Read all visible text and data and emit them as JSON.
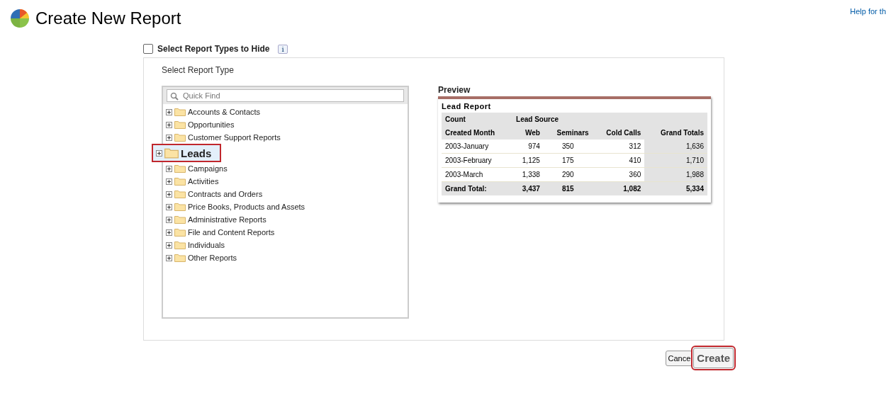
{
  "header": {
    "title": "Create New Report",
    "help_link": "Help for th"
  },
  "hide_option": {
    "label": "Select Report Types to Hide",
    "checked": false,
    "info": "i"
  },
  "selector": {
    "label": "Select Report Type",
    "search": {
      "placeholder": "Quick Find"
    },
    "items": [
      {
        "label": "Accounts & Contacts",
        "selected": false,
        "callout": false
      },
      {
        "label": "Opportunities",
        "selected": false,
        "callout": false
      },
      {
        "label": "Customer Support Reports",
        "selected": false,
        "callout": false
      },
      {
        "label": "Leads",
        "selected": true,
        "callout": true
      },
      {
        "label": "Campaigns",
        "selected": false,
        "callout": false
      },
      {
        "label": "Activities",
        "selected": false,
        "callout": false
      },
      {
        "label": "Contracts and Orders",
        "selected": false,
        "callout": false
      },
      {
        "label": "Price Books, Products and Assets",
        "selected": false,
        "callout": false
      },
      {
        "label": "Administrative Reports",
        "selected": false,
        "callout": false
      },
      {
        "label": "File and Content Reports",
        "selected": false,
        "callout": false
      },
      {
        "label": "Individuals",
        "selected": false,
        "callout": false
      },
      {
        "label": "Other Reports",
        "selected": false,
        "callout": false
      }
    ]
  },
  "preview": {
    "label": "Preview",
    "report_title": "Lead Report",
    "group_header": [
      "Count",
      "Lead Source"
    ],
    "columns": [
      "Created Month",
      "Web",
      "Seminars",
      "Cold Calls",
      "Grand Totals"
    ],
    "rows": [
      [
        "2003-January",
        "974",
        "350",
        "312",
        "1,636"
      ],
      [
        "2003-February",
        "1,125",
        "175",
        "410",
        "1,710"
      ],
      [
        "2003-March",
        "1,338",
        "290",
        "360",
        "1,988"
      ]
    ],
    "total": [
      "Grand Total:",
      "3,437",
      "815",
      "1,082",
      "5,334"
    ]
  },
  "buttons": [
    {
      "label": "Cance",
      "callout": false
    },
    {
      "label": "Create",
      "callout": true
    }
  ]
}
